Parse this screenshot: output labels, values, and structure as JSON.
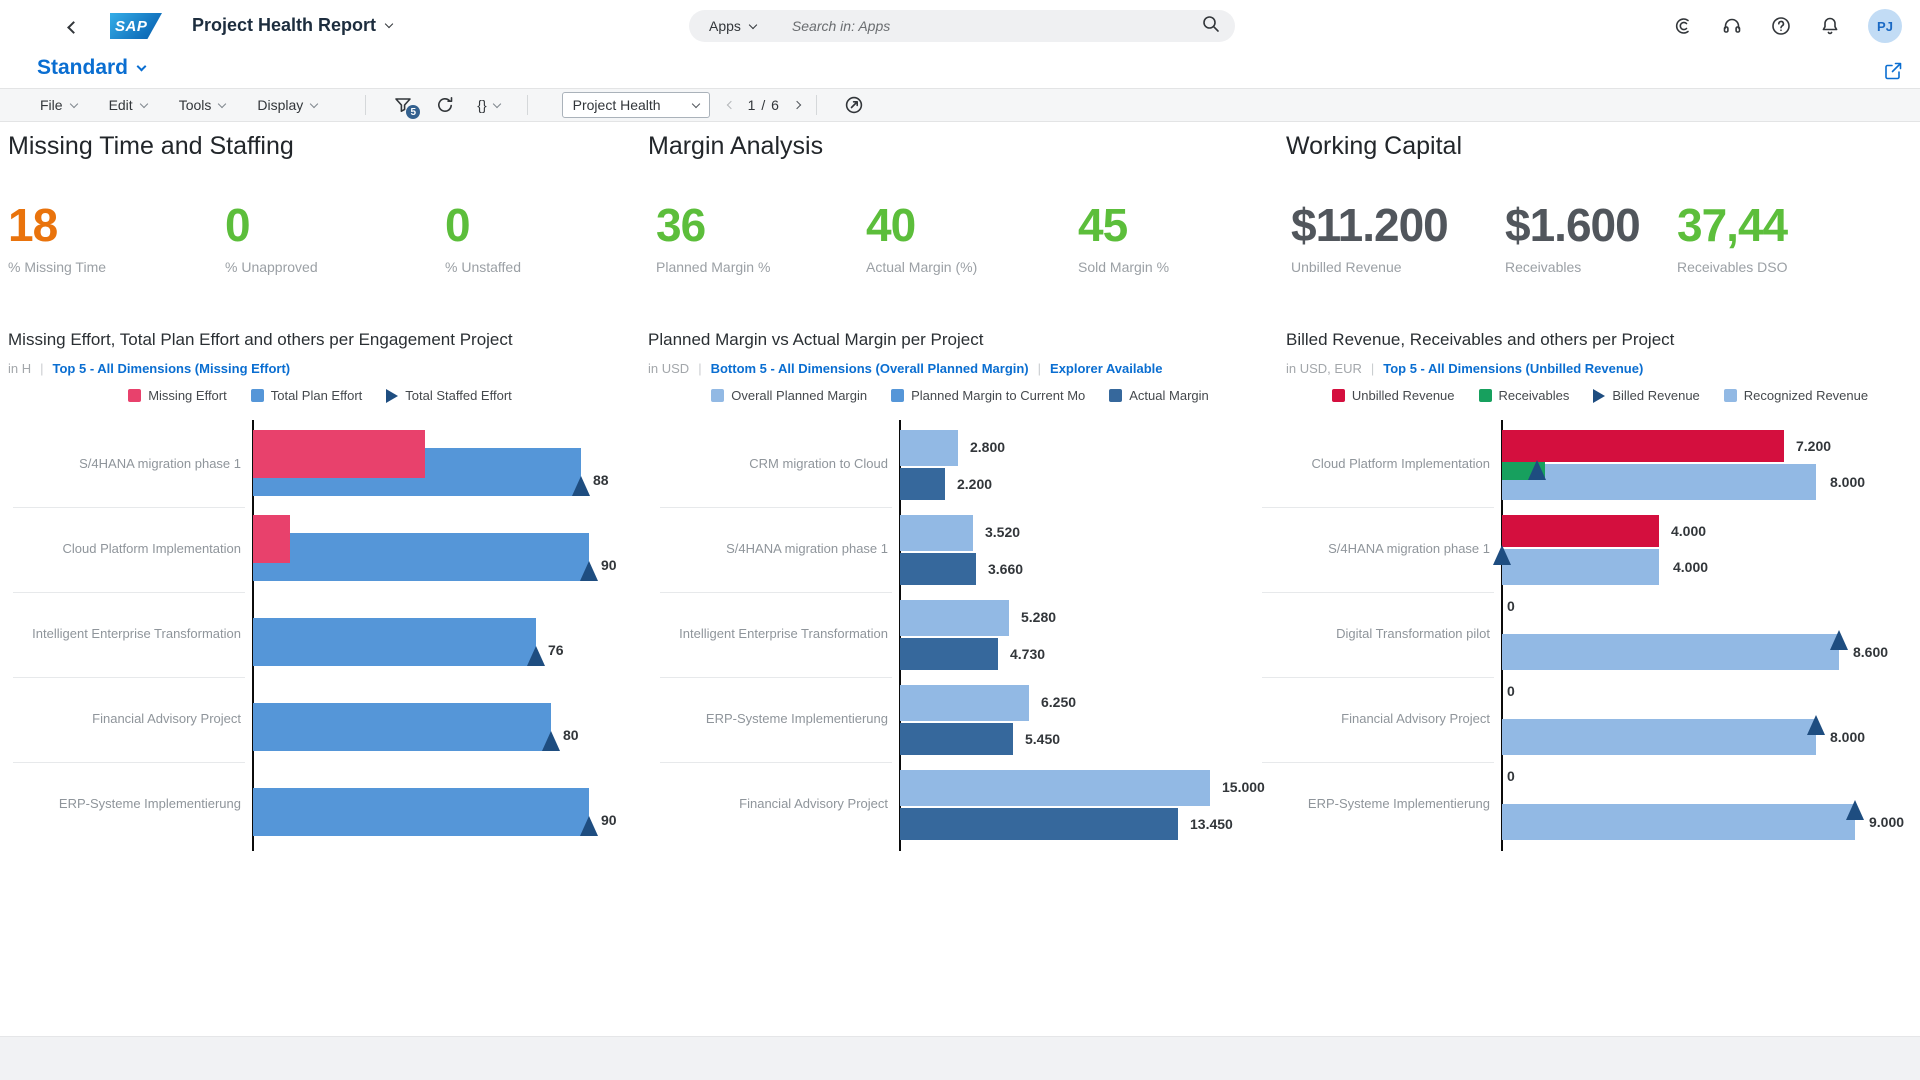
{
  "header": {
    "logo": "SAP",
    "title": "Project Health Report",
    "search": {
      "scope": "Apps",
      "placeholder": "Search in: Apps"
    },
    "avatar_initials": "PJ"
  },
  "view_row": {
    "view_mode": "Standard"
  },
  "toolbar": {
    "menus": [
      "File",
      "Edit",
      "Tools",
      "Display"
    ],
    "filter_badge": "5",
    "braces_label": "{}",
    "page_section": "Project Health",
    "page_indicator": "1 / 6"
  },
  "colors": {
    "accent_blue": "#0a6ed1",
    "kpi_orange": "#e9730c",
    "kpi_green": "#5cbe3b",
    "kpi_dark": "#51565c",
    "missing_effort_pink": "#e8416c",
    "plan_blue": "#5596d8",
    "light_blue": "#92b9e4",
    "actual_dark_blue": "#36689c",
    "unbilled_crimson": "#d40f3e",
    "receivables_green": "#17a05e",
    "marker_navy": "#1e4d80"
  },
  "sections": [
    {
      "title": "Missing Time and Staffing",
      "kpis": [
        {
          "value": "18",
          "label": "% Missing Time",
          "color": "#e9730c"
        },
        {
          "value": "0",
          "label": "% Unapproved",
          "color": "#5cbe3b"
        },
        {
          "value": "0",
          "label": "% Unstaffed",
          "color": "#5cbe3b"
        }
      ]
    },
    {
      "title": "Margin Analysis",
      "kpis": [
        {
          "value": "36",
          "label": "Planned Margin %",
          "color": "#5cbe3b"
        },
        {
          "value": "40",
          "label": "Actual Margin (%)",
          "color": "#5cbe3b"
        },
        {
          "value": "45",
          "label": "Sold Margin %",
          "color": "#5cbe3b"
        }
      ]
    },
    {
      "title": "Working Capital",
      "kpis": [
        {
          "value": "$11.200",
          "label": "Unbilled Revenue",
          "color": "#51565c"
        },
        {
          "value": "$1.600",
          "label": "Receivables",
          "color": "#51565c"
        },
        {
          "value": "37,44",
          "label": "Receivables DSO",
          "color": "#5cbe3b"
        }
      ]
    }
  ],
  "chart_data": [
    {
      "type": "bar",
      "orientation": "horizontal",
      "title": "Missing Effort, Total Plan Effort and others per Engagement Project",
      "unit": "in H",
      "links": [
        "Top 5 - All Dimensions (Missing Effort)"
      ],
      "legend": [
        {
          "label": "Missing Effort",
          "color": "#e8416c",
          "shape": "square"
        },
        {
          "label": "Total Plan Effort",
          "color": "#5596d8",
          "shape": "square"
        },
        {
          "label": "Total Staffed Effort",
          "color": "#1e4d80",
          "shape": "triangle"
        }
      ],
      "categories": [
        "S/4HANA migration phase 1",
        "Cloud Platform Implementation",
        "Intelligent Enterprise Transformation",
        "Financial Advisory Project",
        "ERP-Systeme Implementierung"
      ],
      "series": [
        {
          "name": "Missing Effort",
          "values": [
            46,
            10,
            0,
            0,
            0
          ],
          "labels": [
            "",
            "",
            "",
            "",
            ""
          ]
        },
        {
          "name": "Total Plan Effort",
          "values": [
            88,
            90,
            76,
            80,
            90
          ],
          "labels": [
            "",
            "",
            "",
            "",
            ""
          ]
        },
        {
          "name": "Total Staffed Effort",
          "values": [
            88,
            90,
            76,
            80,
            90
          ],
          "labels": [
            "88",
            "90",
            "76",
            "80",
            "90"
          ]
        }
      ],
      "xlim": [
        0,
        92
      ],
      "grid": false,
      "legend_position": "top"
    },
    {
      "type": "bar",
      "orientation": "horizontal",
      "title": "Planned Margin vs Actual Margin per Project",
      "unit": "in USD",
      "links": [
        "Bottom 5 - All Dimensions (Overall Planned Margin)",
        "Explorer Available"
      ],
      "legend": [
        {
          "label": "Overall Planned Margin",
          "color": "#92b9e4",
          "shape": "square"
        },
        {
          "label": "Planned Margin to Current Mo",
          "color": "#5596d8",
          "shape": "square"
        },
        {
          "label": "Actual Margin",
          "color": "#36689c",
          "shape": "square"
        }
      ],
      "categories": [
        "CRM migration to Cloud",
        "S/4HANA migration phase 1",
        "Intelligent Enterprise Transformation",
        "ERP-Systeme Implementierung",
        "Financial Advisory Project"
      ],
      "series": [
        {
          "name": "Overall Planned Margin",
          "values": [
            2800,
            3520,
            5280,
            6250,
            15000
          ],
          "labels": [
            "2.800",
            "3.520",
            "5.280",
            "6.250",
            "15.000"
          ]
        },
        {
          "name": "Planned Margin to Current Mo",
          "values": [],
          "labels": []
        },
        {
          "name": "Actual Margin",
          "values": [
            2200,
            3660,
            4730,
            5450,
            13450
          ],
          "labels": [
            "2.200",
            "3.660",
            "4.730",
            "5.450",
            "13.450"
          ]
        }
      ],
      "xlim": [
        0,
        16000
      ],
      "grid": false,
      "legend_position": "top"
    },
    {
      "type": "bar",
      "orientation": "horizontal",
      "title": "Billed Revenue, Receivables and others per Project",
      "unit": "in USD, EUR",
      "links": [
        "Top 5 - All Dimensions (Unbilled Revenue)"
      ],
      "legend": [
        {
          "label": "Unbilled Revenue",
          "color": "#d40f3e",
          "shape": "square"
        },
        {
          "label": "Receivables",
          "color": "#17a05e",
          "shape": "square"
        },
        {
          "label": "Billed Revenue",
          "color": "#1e4d80",
          "shape": "triangle"
        },
        {
          "label": "Recognized Revenue",
          "color": "#92b9e4",
          "shape": "square"
        }
      ],
      "categories": [
        "Cloud Platform Implementation",
        "S/4HANA migration phase 1",
        "Digital Transformation pilot",
        "Financial Advisory Project",
        "ERP-Systeme Implementierung"
      ],
      "series": [
        {
          "name": "Unbilled Revenue",
          "values": [
            7200,
            4000,
            0,
            0,
            0
          ],
          "labels": [
            "7.200",
            "4.000",
            "0",
            "0",
            "0"
          ]
        },
        {
          "name": "Receivables",
          "values": [
            1100,
            0,
            0,
            0,
            0
          ],
          "labels": [
            "",
            "",
            "",
            "",
            ""
          ]
        },
        {
          "name": "Billed Revenue",
          "values": [
            900,
            0,
            8600,
            8000,
            9000
          ],
          "labels": [
            "",
            "",
            "",
            "",
            ""
          ]
        },
        {
          "name": "Recognized Revenue",
          "values": [
            8000,
            4000,
            8600,
            8000,
            9000
          ],
          "labels": [
            "8.000",
            "4.000",
            "8.600",
            "8.000",
            "9.000"
          ]
        }
      ],
      "xlim": [
        0,
        9400
      ],
      "grid": false,
      "legend_position": "top"
    }
  ]
}
